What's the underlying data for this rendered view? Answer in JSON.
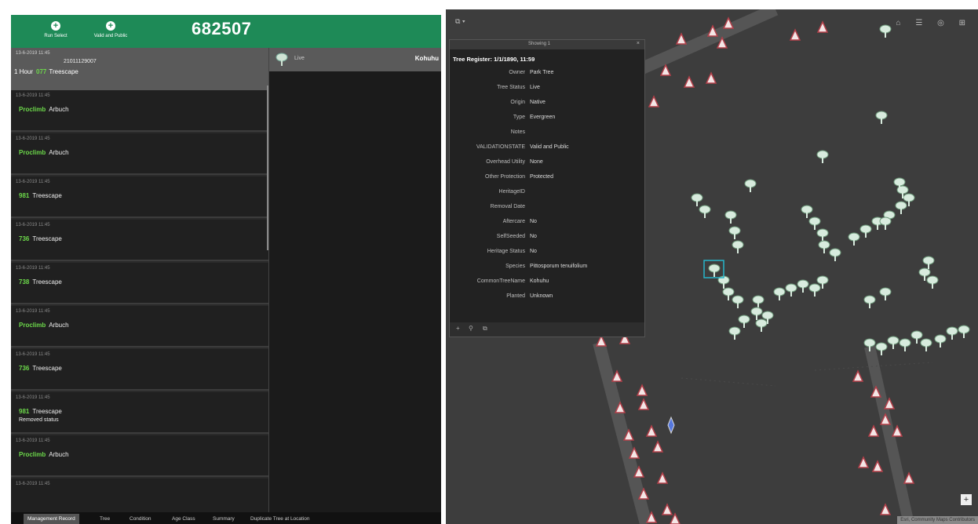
{
  "left": {
    "toolbar": {
      "buttons": [
        {
          "label": "Run Select",
          "icon": "plus-icon"
        },
        {
          "label": "Valid and Public",
          "icon": "plus-icon"
        }
      ],
      "record_id": "682507"
    },
    "current": {
      "timestamp": "13-6-2019 11:45",
      "code": "21011129007",
      "hours_label": "1 Hour",
      "number": "077",
      "company": "Treescape"
    },
    "records": [
      {
        "timestamp": "13-6-2019 11:45",
        "number": "Proclimb",
        "label": "Arbuch",
        "sub": ""
      },
      {
        "timestamp": "13-6-2019 11:45",
        "number": "Proclimb",
        "label": "Arbuch",
        "sub": ""
      },
      {
        "timestamp": "13-6-2019 11:45",
        "number": "981",
        "label": "Treescape",
        "sub": ""
      },
      {
        "timestamp": "13-6-2019 11:45",
        "number": "736",
        "label": "Treescape",
        "sub": ""
      },
      {
        "timestamp": "13-6-2019 11:45",
        "number": "738",
        "label": "Treescape",
        "sub": ""
      },
      {
        "timestamp": "13-6-2019 11:45",
        "number": "Proclimb",
        "label": "Arbuch",
        "sub": ""
      },
      {
        "timestamp": "13-6-2019 11:45",
        "number": "736",
        "label": "Treescape",
        "sub": ""
      },
      {
        "timestamp": "13-6-2019 11:45",
        "number": "981",
        "label": "Treescape",
        "sub": "Removed status"
      },
      {
        "timestamp": "13-6-2019 11:45",
        "number": "Proclimb",
        "label": "Arbuch",
        "sub": ""
      },
      {
        "timestamp": "13-6-2019 11:45",
        "number": "",
        "label": "",
        "sub": ""
      }
    ],
    "detail": {
      "status": "Live",
      "name": "Kohuhu"
    },
    "tabs": [
      "Management Record",
      "Tree",
      "Condition",
      "Age Class",
      "Summary",
      "Duplicate Tree at Location"
    ],
    "active_tab": 0
  },
  "map": {
    "popup": {
      "title": "Showing 1",
      "close": "×",
      "heading": "Tree Register: 1/1/1890, 11:59",
      "rows": [
        {
          "key": "Owner",
          "value": "Park Tree"
        },
        {
          "key": "Tree Status",
          "value": "Live"
        },
        {
          "key": "Origin",
          "value": "Native"
        },
        {
          "key": "Type",
          "value": "Evergreen"
        },
        {
          "key": "Notes",
          "value": ""
        },
        {
          "key": "VALIDATIONSTATE",
          "value": "Valid and Public"
        },
        {
          "key": "Overhead Utility",
          "value": "None"
        },
        {
          "key": "Other Protection",
          "value": "Protected"
        },
        {
          "key": "HeritageID",
          "value": ""
        },
        {
          "key": "Removal Date",
          "value": ""
        },
        {
          "key": "Aftercare",
          "value": "No"
        },
        {
          "key": "SelfSeeded",
          "value": "No"
        },
        {
          "key": "Heritage Status",
          "value": "No"
        },
        {
          "key": "Species",
          "value": "Pittosporum tenuifolium"
        },
        {
          "key": "CommonTreeName",
          "value": "Kohuhu"
        },
        {
          "key": "Planted",
          "value": "Unknown"
        }
      ],
      "footer_icons": [
        "+",
        "⚲",
        "⧉"
      ]
    },
    "tools": "⧉ ▾",
    "top_right_icons": "⌂ ☰ ◎ ⊞",
    "zoom": "+",
    "attribution": "Esri, Community Maps Contributors",
    "colors": {
      "accent_green": "#1e8a57",
      "highlight_green": "#6cd84a",
      "map_bg": "#3d3d3d"
    }
  }
}
